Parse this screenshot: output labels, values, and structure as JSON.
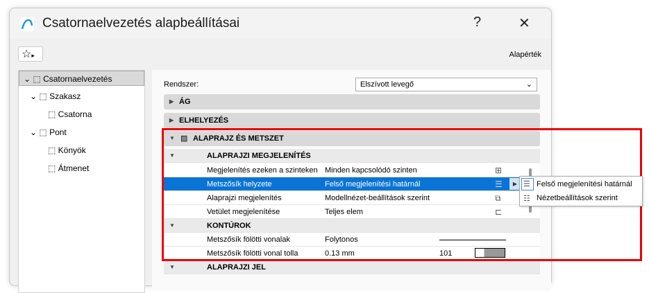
{
  "window": {
    "title": "Csatornaelvezetés alapbeállításai",
    "help": "?",
    "close": "✕"
  },
  "toolbar": {
    "favorites_icon": "☆",
    "arrow": "▸",
    "default_label": "Alapérték"
  },
  "tree": [
    {
      "label": "Csatornaelvezetés",
      "selected": true
    },
    {
      "label": "Szakasz"
    },
    {
      "label": "Csatorna"
    },
    {
      "label": "Pont"
    },
    {
      "label": "Könyök"
    },
    {
      "label": "Átmenet"
    }
  ],
  "system": {
    "label": "Rendszer:",
    "value": "Elszívott levegő"
  },
  "sections": {
    "ag": "ÁG",
    "elhelyezes": "ELHELYEZÉS",
    "alaprajz": "ALAPRAJZ ÉS METSZET",
    "alaprajzi_jel": "ALAPRAJZI JEL"
  },
  "groups": {
    "megjelenites": "ALAPRAJZI MEGJELENÍTÉS",
    "konturok": "KONTÚROK"
  },
  "rows": [
    {
      "label": "Megjelenítés ezeken a szinteken",
      "value": "Minden kapcsolódó szinten"
    },
    {
      "label": "Metszősík helyzete",
      "value": "Felső megjelenítési határnál"
    },
    {
      "label": "Alaprajzi megjelenítés",
      "value": "Modellnézet-beállítások szerint"
    },
    {
      "label": "Vetület megjelenítése",
      "value": "Teljes elem"
    },
    {
      "label": "Metszősík fölötti vonalak",
      "value": "Folytonos"
    },
    {
      "label": "Metszősík fölötti vonal tolla",
      "value": "0.13 mm",
      "pen": "101"
    }
  ],
  "popup": [
    "Felső megjelenítési határnál",
    "Nézetbeállítások szerint"
  ]
}
